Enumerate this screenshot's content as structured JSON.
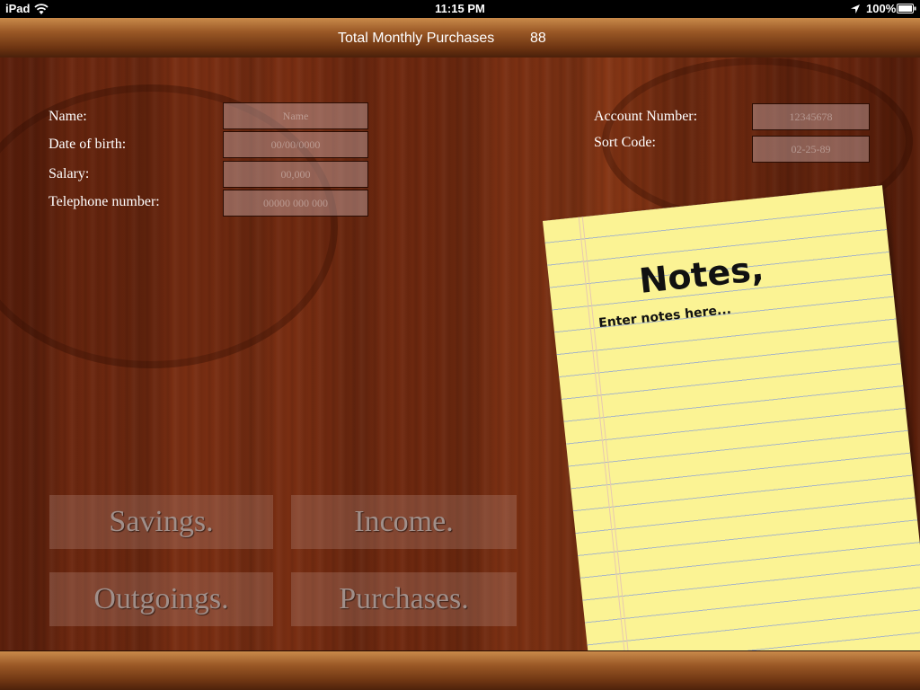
{
  "status_bar": {
    "carrier": "iPad",
    "time": "11:15 PM",
    "battery": "100%",
    "icons": [
      "wifi-icon",
      "location-icon",
      "battery-icon"
    ]
  },
  "header": {
    "title": "Total Monthly Purchases",
    "count": "88"
  },
  "form": {
    "name_label": "Name:",
    "name_placeholder": "Name",
    "dob_label": "Date of birth:",
    "dob_placeholder": "00/00/0000",
    "salary_label": "Salary:",
    "salary_placeholder": "00,000",
    "phone_label": "Telephone number:",
    "phone_placeholder": "00000 000 000",
    "account_label": "Account Number:",
    "account_placeholder": "12345678",
    "sort_label": "Sort Code:",
    "sort_placeholder": "02-25-89"
  },
  "nav": {
    "savings": "Savings.",
    "income": "Income.",
    "outgoings": "Outgoings.",
    "purchases": "Purchases."
  },
  "notes": {
    "title": "Notes,",
    "placeholder": "Enter notes here..."
  },
  "colors": {
    "wood": "#6a250f",
    "toolbar": "#8a4a1e",
    "paper": "#fbf394",
    "button_text": "#a08f8a"
  }
}
